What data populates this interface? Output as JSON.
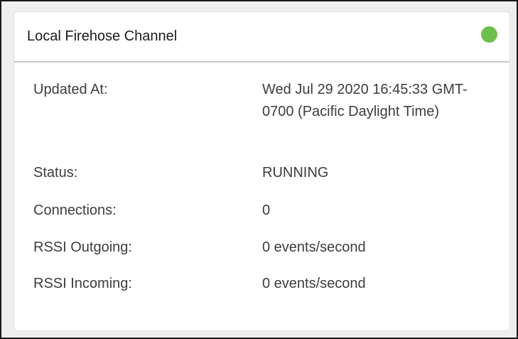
{
  "card": {
    "title": "Local Firehose Channel",
    "status_color": "#6cc04a"
  },
  "details": [
    {
      "label": "Updated At:",
      "value": "Wed Jul 29 2020 16:45:33 GMT-0700 (Pacific Daylight Time)"
    },
    {
      "label": "Status:",
      "value": "RUNNING"
    },
    {
      "label": "Connections:",
      "value": "0"
    },
    {
      "label": "RSSI Outgoing:",
      "value": "0 events/second"
    },
    {
      "label": "RSSI Incoming:",
      "value": "0 events/second"
    }
  ]
}
